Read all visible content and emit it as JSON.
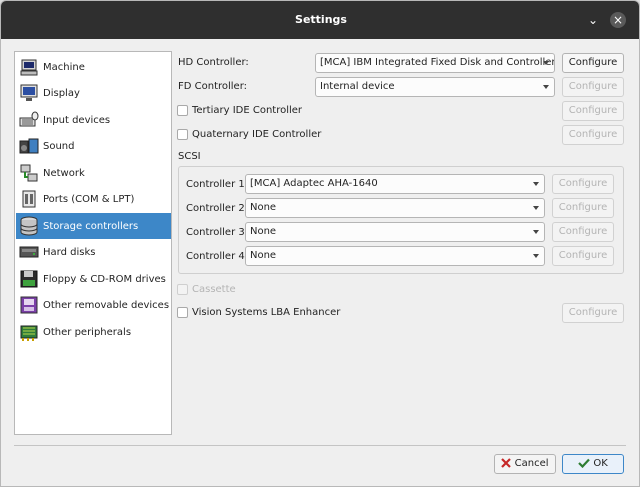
{
  "window": {
    "title": "Settings"
  },
  "titlebar": {
    "minimize_glyph": "⌄",
    "close_glyph": "×"
  },
  "sidebar": {
    "items": [
      {
        "label": "Machine",
        "icon": "machine-icon"
      },
      {
        "label": "Display",
        "icon": "display-icon"
      },
      {
        "label": "Input devices",
        "icon": "keyboard-icon"
      },
      {
        "label": "Sound",
        "icon": "speaker-icon"
      },
      {
        "label": "Network",
        "icon": "network-icon"
      },
      {
        "label": "Ports (COM & LPT)",
        "icon": "ports-icon"
      },
      {
        "label": "Storage controllers",
        "icon": "storage-icon",
        "selected": true
      },
      {
        "label": "Hard disks",
        "icon": "hard-disk-icon"
      },
      {
        "label": "Floppy & CD-ROM drives",
        "icon": "floppy-icon"
      },
      {
        "label": "Other removable devices",
        "icon": "removable-icon"
      },
      {
        "label": "Other peripherals",
        "icon": "peripherals-icon"
      }
    ]
  },
  "main": {
    "hd_controller": {
      "label": "HD Controller:",
      "value": "[MCA] IBM Integrated Fixed Disk and Controller",
      "configure": "Configure"
    },
    "fd_controller": {
      "label": "FD Controller:",
      "value": "Internal device",
      "configure": "Configure"
    },
    "tertiary_ide": {
      "label": "Tertiary IDE Controller",
      "configure": "Configure"
    },
    "quaternary_ide": {
      "label": "Quaternary IDE Controller",
      "configure": "Configure"
    },
    "scsi": {
      "title": "SCSI",
      "controllers": [
        {
          "label": "Controller 1:",
          "value": "[MCA] Adaptec AHA-1640",
          "configure": "Configure"
        },
        {
          "label": "Controller 2:",
          "value": "None",
          "configure": "Configure"
        },
        {
          "label": "Controller 3:",
          "value": "None",
          "configure": "Configure"
        },
        {
          "label": "Controller 4:",
          "value": "None",
          "configure": "Configure"
        }
      ]
    },
    "cassette": {
      "label": "Cassette"
    },
    "vision_lba": {
      "label": "Vision Systems LBA Enhancer",
      "configure": "Configure"
    }
  },
  "footer": {
    "cancel_label": "Cancel",
    "ok_label": "OK"
  },
  "colors": {
    "selection": "#3d87c8",
    "titlebar": "#2f2f2f"
  }
}
